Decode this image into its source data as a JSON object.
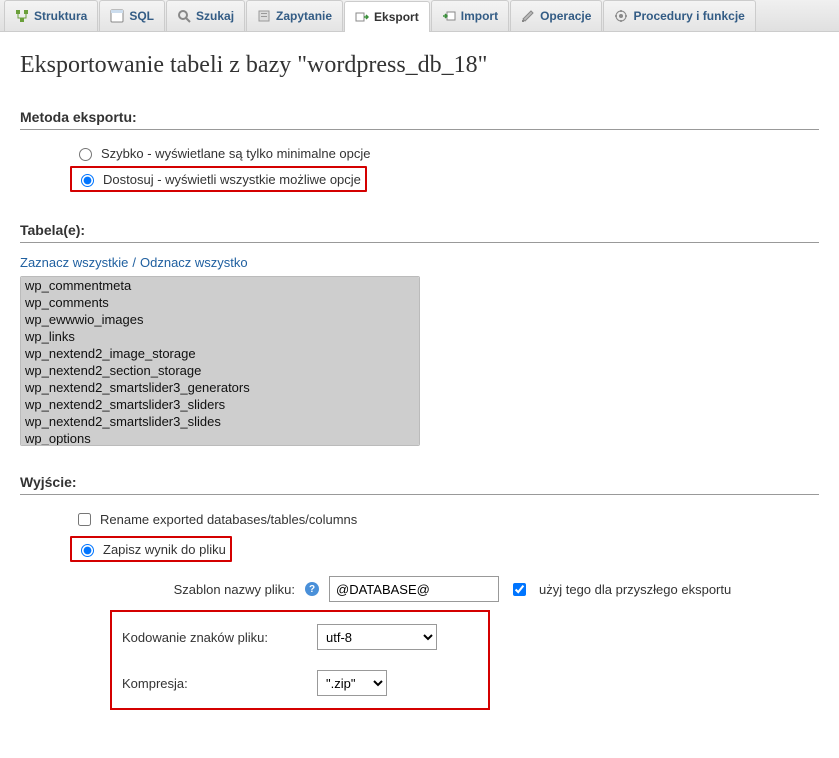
{
  "tabs": [
    {
      "label": "Struktura"
    },
    {
      "label": "SQL"
    },
    {
      "label": "Szukaj"
    },
    {
      "label": "Zapytanie"
    },
    {
      "label": "Eksport"
    },
    {
      "label": "Import"
    },
    {
      "label": "Operacje"
    },
    {
      "label": "Procedury i funkcje"
    }
  ],
  "heading": "Eksportowanie tabeli z bazy \"wordpress_db_18\"",
  "export_method": {
    "title": "Metoda eksportu:",
    "quick_label": "Szybko - wyświetlane są tylko minimalne opcje",
    "custom_label": "Dostosuj - wyświetli wszystkie możliwe opcje"
  },
  "tables": {
    "title": "Tabela(e):",
    "select_all": "Zaznacz wszystkie",
    "unselect_all": "Odznacz wszystko",
    "options": [
      "wp_commentmeta",
      "wp_comments",
      "wp_ewwwio_images",
      "wp_links",
      "wp_nextend2_image_storage",
      "wp_nextend2_section_storage",
      "wp_nextend2_smartslider3_generators",
      "wp_nextend2_smartslider3_sliders",
      "wp_nextend2_smartslider3_slides",
      "wp_options"
    ]
  },
  "output": {
    "title": "Wyjście:",
    "rename_label": "Rename exported databases/tables/columns",
    "save_file_label": "Zapisz wynik do pliku",
    "template_label": "Szablon nazwy pliku:",
    "template_value": "@DATABASE@",
    "future_label": "użyj tego dla przyszłego eksportu",
    "encoding_label": "Kodowanie znaków pliku:",
    "encoding_value": "utf-8",
    "compression_label": "Kompresja:",
    "compression_value": "\".zip\""
  }
}
